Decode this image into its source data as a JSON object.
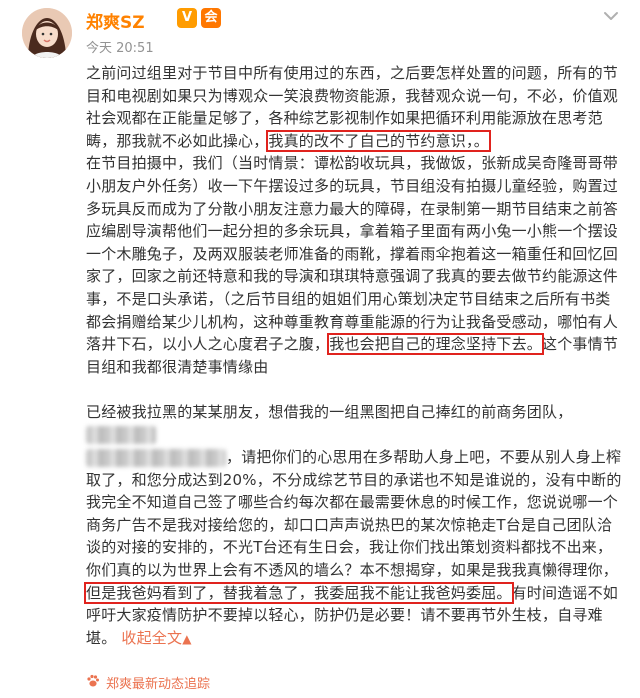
{
  "post": {
    "author": "郑爽SZ",
    "badges": [
      "V",
      "会"
    ],
    "time": "今天 20:51",
    "p1_a": "之前问过组里对于节目中所有使用过的东西，之后要怎样处置的问题，所有的节目和电视剧如果只为博观众一笑浪费物资能源，我替观众说一句，不必，价值观社会观都在正能量足够了，各种综艺影视制作如果把循环利用能源放在思考范畴，那我就不必如此操心，",
    "p1_hl": "我真的改不了自己的节约意识，。",
    "p2_a": "在节目拍摄中，我们（当时情景：谭松韵收玩具，我做饭，张新成吴奇隆哥哥带小朋友户外任务）收一下午摆设过多的玩具，节目组没有拍摄儿童经验，购置过多玩具反而成为了分散小朋友注意力最大的障碍，在录制第一期节目结束之前答应编剧导演帮他们一起分担的多余玩具，拿着箱子里面有两小兔一小熊一个摆设一个木雕兔子，及两双服装老师准备的雨靴，撑着雨伞抱着这一箱重任和回忆回家了，回家之前还特意和我的导演和琪琪特意强调了我真的要去做节约能源这件事，不是口头承诺，（之后节目组的姐姐们用心策划决定节目结束之后所有书类都会捐赠给某少儿机构，这种尊重教育尊重能源的行为让我备受感动，哪怕有人落井下石，以小人之心度君子之腹，",
    "p2_hl": "我也会把自己的理念坚持下去。",
    "p2_b": "这个事情节目组和我都很清楚事情缘由",
    "p3_a": "已经被我拉黑的某某朋友，想借我的一组黑图把自己捧红的前商务团队，",
    "p3_b": "，请把你们的心思用在多帮助人身上吧，不要从别人身上榨取了，和您分成达到20%，不分成综艺节目的承诺也不知是谁说的，没有中断的我完全不知道自己签了哪些合约每次都在最需要休息的时候工作，您说说哪一个商务广告不是我对接给您的，却口口声声说热巴的某次惊艳走T台是自己团队洽谈的对接的安排的，不光T台还有生日会，我让你们找出策划资料都找不出来，你们真的以为世界上会有不透风的墙么？本不想揭穿，如果是我我真懒得理你，",
    "p3_hl": "但是我爸妈看到了，替我着急了，我委屈我不能让我爸妈委屈。",
    "p3_c": "有时间造谣不如呼吁大家疫情防护不要掉以轻心，防护仍是必要！请不要再节外生枝，自寻难堪。",
    "collapse": "收起全文",
    "collapse_icon": "up-caret",
    "footer_link": "郑爽最新动态追踪",
    "footer_icon": "paw-icon"
  },
  "colors": {
    "name": "#ff8200",
    "highlight_box": "#e0231e",
    "link": "#eb7350",
    "body_text": "#333333",
    "time": "#939393"
  }
}
